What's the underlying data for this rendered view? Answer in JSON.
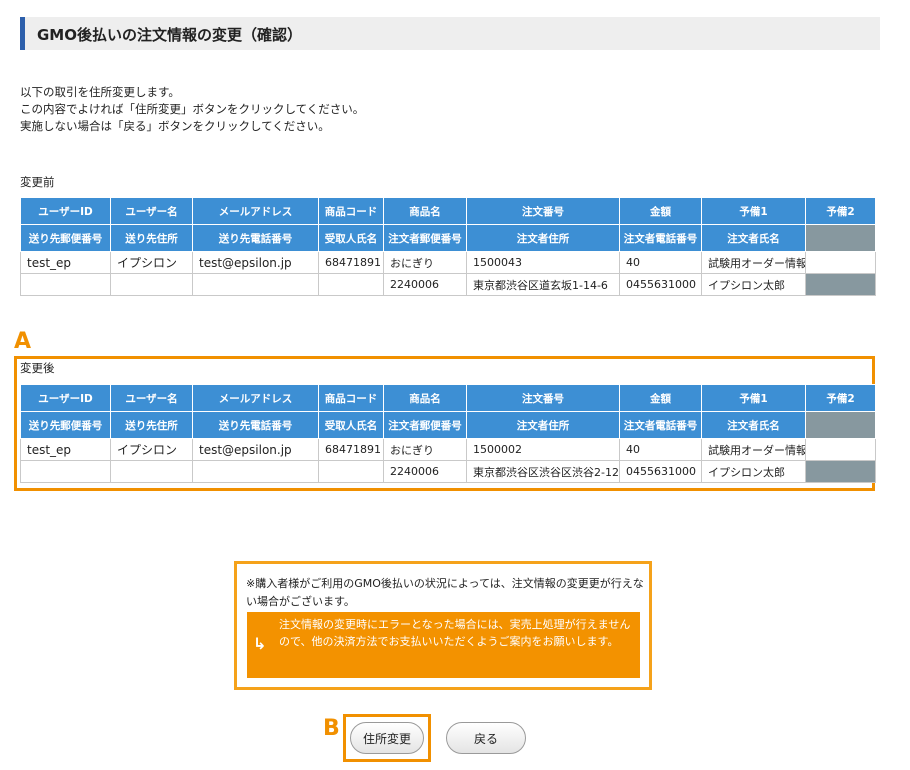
{
  "page": {
    "title": "GMO後払いの注文情報の変更（確認）",
    "intro": [
      "以下の取引を住所変更します。",
      "この内容でよければ「住所変更」ボタンをクリックしてください。",
      "実施しない場合は「戻る」ボタンをクリックしてください。"
    ]
  },
  "table_headers": {
    "row1": [
      "ユーザーID",
      "ユーザー名",
      "メールアドレス",
      "商品コード",
      "商品名",
      "注文番号",
      "金額",
      "予備1",
      "予備2"
    ],
    "row2": [
      "送り先郵便番号",
      "送り先住所",
      "送り先電話番号",
      "受取人氏名",
      "注文者郵便番号",
      "注文者住所",
      "注文者電話番号",
      "注文者氏名"
    ]
  },
  "before": {
    "label": "変更前",
    "row1": [
      "test_ep",
      "イプシロン",
      "test@epsilon.jp",
      "68471891",
      "おにぎり",
      "1500043",
      "40",
      "試験用オーダー情報",
      ""
    ],
    "row2": [
      "",
      "",
      "",
      "",
      "2240006",
      "東京都渋谷区道玄坂1-14-6",
      "0455631000",
      "イプシロン太郎"
    ]
  },
  "after": {
    "label": "変更後",
    "row1": [
      "test_ep",
      "イプシロン",
      "test@epsilon.jp",
      "68471891",
      "おにぎり",
      "1500002",
      "40",
      "試験用オーダー情報",
      ""
    ],
    "row2": [
      "",
      "",
      "",
      "",
      "2240006",
      "東京都渋谷区渋谷区渋谷2-12",
      "0455631000",
      "イプシロン太郎"
    ]
  },
  "markers": {
    "a": "A",
    "b": "B"
  },
  "notice": {
    "text": "※購入者様がご利用のGMO後払いの状況によっては、注文情報の変更更が行えない場合がございます。",
    "warning": "注文情報の変更時にエラーとなった場合には、実売上処理が行えませんので、他の決済方法でお支払いいただくようご案内をお願いします。",
    "arrow_icon": "↳"
  },
  "buttons": {
    "change": "住所変更",
    "back": "戻る"
  },
  "colors": {
    "header_blue": "#3d8fd4",
    "header_gray": "#87989f",
    "highlight_orange": "#f19000",
    "warning_bg": "#f39200"
  }
}
